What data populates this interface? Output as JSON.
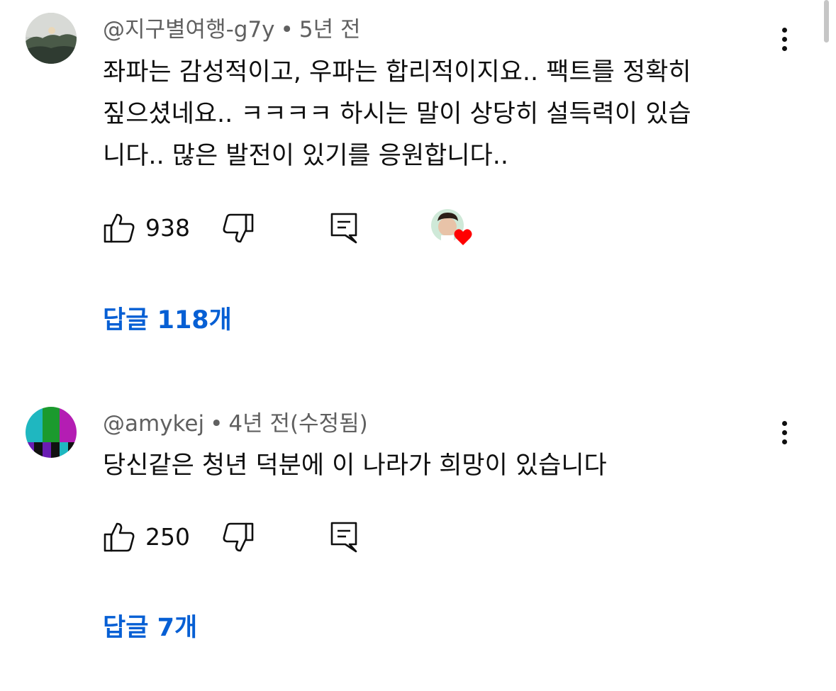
{
  "comments": [
    {
      "author": "@지구별여행-g7y",
      "separator": "•",
      "time": "5년 전",
      "text": "좌파는 감성적이고, 우파는 합리적이지요..  팩트를 정확히\n짚으셨네요..  ㅋㅋㅋㅋ  하시는 말이 상당히 설득력이 있습\n니다..  많은 발전이 있기를 응원합니다..",
      "likes": "938",
      "replies_label": "답글 118개",
      "creator_hearted": true,
      "icons": {
        "like": "thumbs-up-icon",
        "dislike": "thumbs-down-icon",
        "reply": "reply-icon",
        "menu": "more-vert-icon"
      }
    },
    {
      "author": "@amykej",
      "separator": "•",
      "time": "4년 전(수정됨)",
      "text": "당신같은 청년 덕분에 이 나라가 희망이 있습니다",
      "likes": "250",
      "replies_label": "답글 7개",
      "creator_hearted": false,
      "icons": {
        "like": "thumbs-up-icon",
        "dislike": "thumbs-down-icon",
        "reply": "reply-icon",
        "menu": "more-vert-icon"
      }
    }
  ],
  "colors": {
    "link": "#065fd4",
    "meta": "#606060",
    "text": "#0f0f0f",
    "heart": "#ff0000"
  }
}
